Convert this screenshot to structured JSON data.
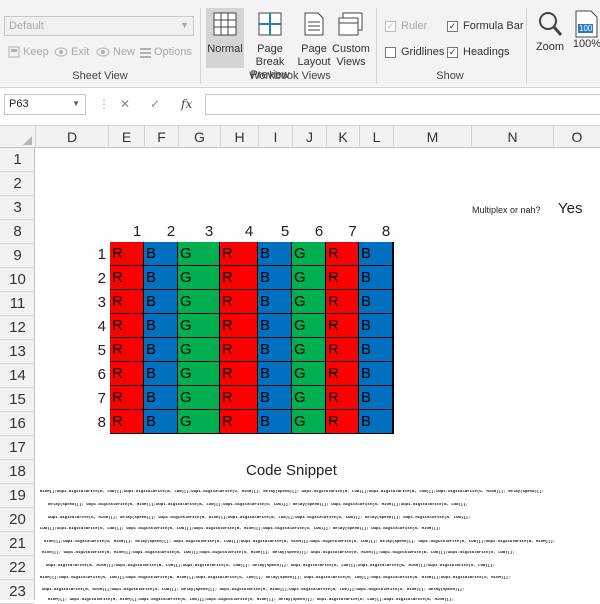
{
  "ribbon": {
    "sheet_view": {
      "dropdown_value": "Default",
      "keep": "Keep",
      "exit": "Exit",
      "new": "New",
      "options": "Options",
      "group_label": "Sheet View"
    },
    "workbook_views": {
      "normal": "Normal",
      "page_break_1": "Page Break",
      "page_break_2": "Preview",
      "page_layout_1": "Page",
      "page_layout_2": "Layout",
      "custom_1": "Custom",
      "custom_2": "Views",
      "group_label": "Workbook Views"
    },
    "show": {
      "ruler": "Ruler",
      "formula_bar": "Formula Bar",
      "gridlines": "Gridlines",
      "headings": "Headings",
      "group_label": "Show"
    },
    "zoom": {
      "zoom": "Zoom",
      "zoom100": "100%",
      "zoom100_icon_text": "100"
    }
  },
  "formula_bar": {
    "name_box": "P63",
    "fx": "fx",
    "value": ""
  },
  "grid": {
    "columns": [
      "D",
      "E",
      "F",
      "G",
      "H",
      "I",
      "J",
      "K",
      "L",
      "M",
      "N",
      "O"
    ],
    "rows": [
      "1",
      "2",
      "3",
      "8",
      "9",
      "10",
      "11",
      "12",
      "13",
      "14",
      "15",
      "16",
      "17",
      "18",
      "19",
      "20",
      "21",
      "22",
      "23"
    ]
  },
  "sheet": {
    "multiplex_question": "Multiplex or nah?",
    "multiplex_answer": "Yes",
    "plate_col_numbers": [
      "1",
      "2",
      "3",
      "4",
      "5",
      "6",
      "7",
      "8"
    ],
    "plate_row_numbers": [
      "1",
      "2",
      "3",
      "4",
      "5",
      "6",
      "7",
      "8"
    ],
    "plate_pattern": [
      "R",
      "B",
      "G",
      "R",
      "B",
      "G",
      "R",
      "B"
    ],
    "code_title": "Code Snippet",
    "code_lines": [
      "HIGH[];wup1.digitalWrite(R, LOW)[];wup1.digitalWrite(B, LOW)[];wup1.digitalWrite(G, HIGH)[]; delay(speed)[]; wup1.digitalWrite(R, LOW)[];wup1.digitalWrite(B, LOW)[];wup1.digitalWrite(G, HIGH)[]; delay(speed)[];",
      "delay(speed)[]; wup1.digitalWrite(R, HIGH)[];wup1.digitalWrite(B, LOW)[];wup1.digitalWrite(G, LOW)[]; delay(speed)[]; wup1.digitalWrite(R, HIGH)[];wup1.digitalWrite(B, LOW)[];",
      "wup1.digitalWrite(G, HIGH)[]; delay(speed)[]; wup1.digitalWrite(R, HIGH)[];wup1.digitalWrite(B, LOW)[];wup1.digitalWrite(G, LOW)[]; delay(speed)[]; wup1.digitalWrite(R, LOW)[];",
      "LOW)[];wup1.digitalWrite(G, LOW)[]; wup1.digitalWrite(R, LOW)[];wup1.digitalWrite(B, HIGH)[];wup1.digitalWrite(G, LOW)[]; delay(speed)[]; wup1.digitalWrite(R, HIGH)[];",
      "HIGH)[];wup1.digitalWrite(G, HIGH)[]; delay(speed)[]; wup1.digitalWrite(R, LOW)[];wup1.digitalWrite(B, HIGH)[];wup1.digitalWrite(G, LOW)[]; delay(speed)[]; wup1.digitalWrite(R, LOW)[];wup1.digitalWrite(B, HIGH)[];",
      "HIGH)[]; wup1.digitalWrite(R, HIGH)[];wup1.digitalWrite(B, LOW)[];wup1.digitalWrite(G, HIGH)[]; delay(speed)[]; wup1.digitalWrite(R, HIGH)[];wup1.digitalWrite(B, LOW)[];wup1.digitalWrite(G, LOW)[];",
      "wup1.digitalWrite(R, HIGH)[];wup1.digitalWrite(B, LOW)[];wup1.digitalWrite(G, LOW)[]; delay(speed)[]; wup1.digitalWrite(R, LOW)[];wup1.digitalWrite(B, HIGH)[];wup1.digitalWrite(G, LOW)[];",
      "HIGH)[];wup1.digitalWrite(R, LOW)[];wup1.digitalWrite(B, HIGH)[];wup1.digitalWrite(G, LOW)[]; delay(speed)[]; wup1.digitalWrite(R, LOW)[];wup1.digitalWrite(B, HIGH)[];wup1.digitalWrite(G, HIGH)[];",
      "wup1.digitalWrite(B, HIGH)[];wup1.digitalWrite(G, LOW)[]; delay(speed)[]; wup1.digitalWrite(R, HIGH)[];wup1.digitalWrite(B, LOW)[];wup1.digitalWrite(G, HIGH)[]; delay(speed)[];",
      "HIGH)[]; wup1.digitalWrite(R, HIGH)[];wup1.digitalWrite(B, LOW)[];wup1.digitalWrite(G, HIGH)[]; delay(speed)[]; wup1.digitalWrite(R, LOW)[];wup1.digitalWrite(B, HIGH)[];"
    ]
  }
}
